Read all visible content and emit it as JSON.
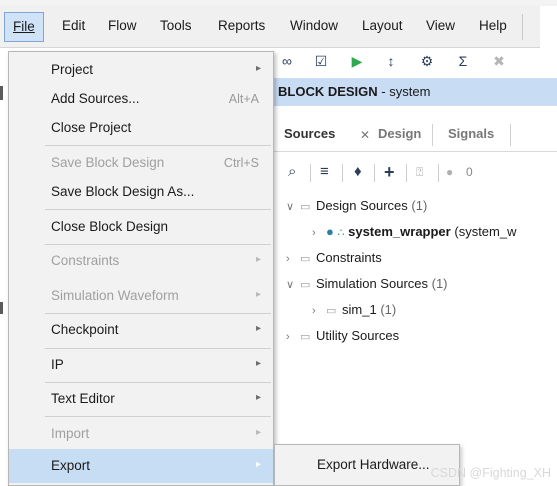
{
  "menubar": {
    "items": [
      "File",
      "Edit",
      "Flow",
      "Tools",
      "Reports",
      "Window",
      "Layout",
      "View",
      "Help"
    ]
  },
  "block_design": {
    "title_bold": "BLOCK DESIGN",
    "title_rest": " - system"
  },
  "sources": {
    "tabs": [
      "Sources",
      "Design",
      "Signals"
    ],
    "badge_count": "0",
    "tree": [
      {
        "label": "Design Sources",
        "count": "(1)"
      },
      {
        "label": "system_wrapper",
        "detail": "(system_w"
      },
      {
        "label": "Constraints"
      },
      {
        "label": "Simulation Sources",
        "count": "(1)"
      },
      {
        "label": "sim_1",
        "count": "(1)"
      },
      {
        "label": "Utility Sources"
      }
    ]
  },
  "file_menu": {
    "items": [
      {
        "label": "Project"
      },
      {
        "label": "Add Sources...",
        "accel": "Alt+A"
      },
      {
        "label": "Close Project"
      },
      {
        "label": "Save Block Design",
        "accel": "Ctrl+S"
      },
      {
        "label": "Save Block Design As..."
      },
      {
        "label": "Close Block Design"
      },
      {
        "label": "Constraints"
      },
      {
        "label": "Simulation Waveform"
      },
      {
        "label": "Checkpoint"
      },
      {
        "label": "IP"
      },
      {
        "label": "Text Editor"
      },
      {
        "label": "Import"
      },
      {
        "label": "Export"
      }
    ]
  },
  "export_submenu": {
    "items": [
      "Export Hardware..."
    ]
  },
  "watermark": "CSDN @Fighting_XH",
  "colors": {
    "menu_highlight": "#c7ddf4",
    "header_bg": "#c8dcf3",
    "run_icon": "#2fa84f",
    "status_dot": "#2b7fa3"
  }
}
